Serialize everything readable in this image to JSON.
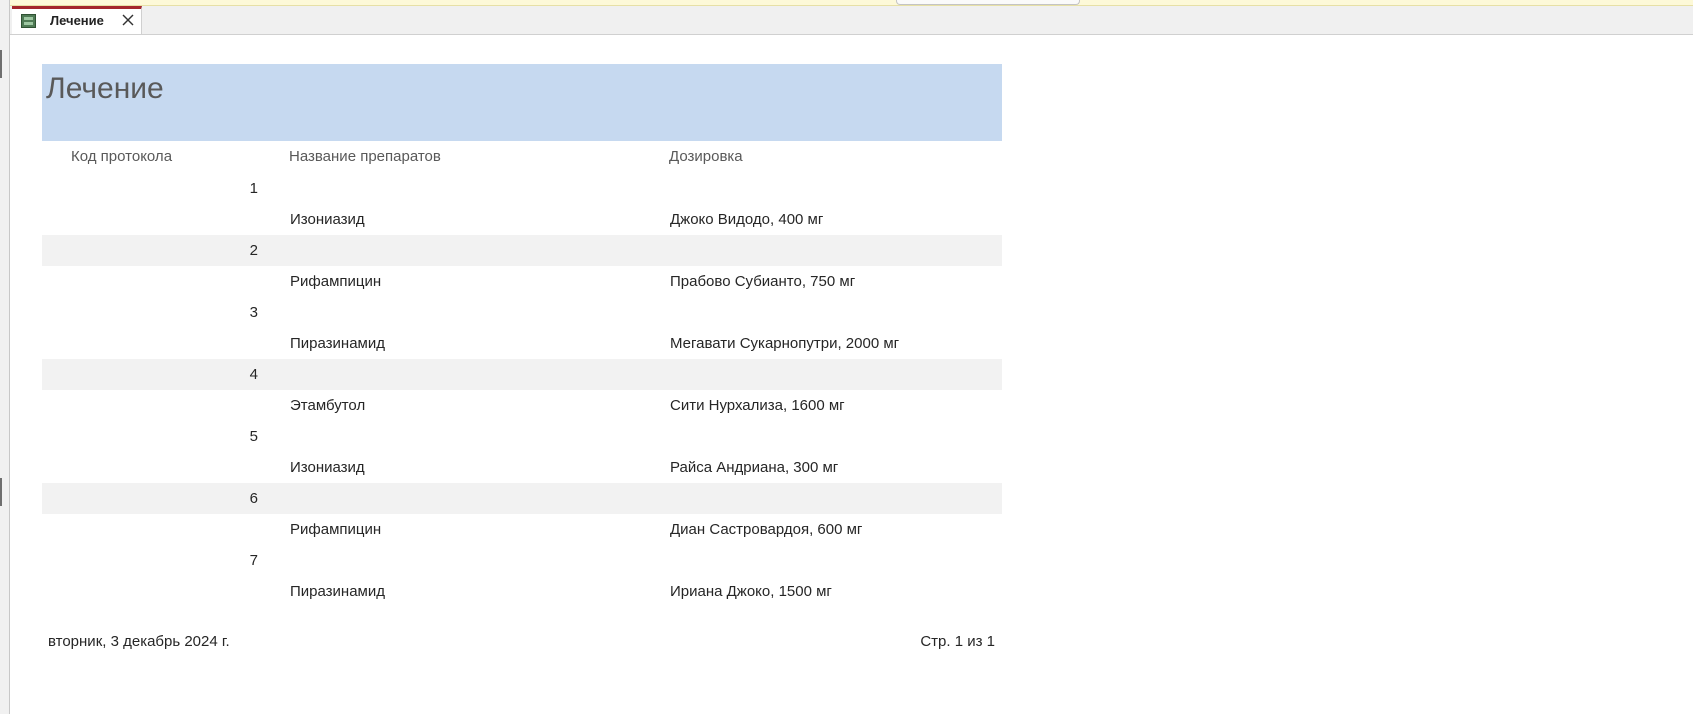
{
  "tab": {
    "label": "Лечение",
    "icon": "report-icon",
    "close_icon": "close-icon"
  },
  "report": {
    "title": "Лечение",
    "columns": {
      "code": "Код протокола",
      "drug": "Название препаратов",
      "dose": "Дозировка"
    },
    "rows": [
      {
        "code": "1",
        "drug": "Изониазид",
        "dose": "Джоко Видодо, 400 мг"
      },
      {
        "code": "2",
        "drug": "Рифампицин",
        "dose": "Прабово Субианто, 750 мг"
      },
      {
        "code": "3",
        "drug": "Пиразинамид",
        "dose": "Мегавати Сукарнопутри, 2000 мг"
      },
      {
        "code": "4",
        "drug": "Этамбутол",
        "dose": "Сити Нурхализа, 1600 мг"
      },
      {
        "code": "5",
        "drug": "Изониазид",
        "dose": "Райса Андриана, 300 мг"
      },
      {
        "code": "6",
        "drug": "Рифампицин",
        "dose": "Диан Састровардоя, 600 мг"
      },
      {
        "code": "7",
        "drug": "Пиразинамид",
        "dose": "Ириана Джоко, 1500 мг"
      }
    ],
    "footer": {
      "date": "вторник, 3 декабрь 2024 г.",
      "page": "Стр. 1 из 1"
    }
  },
  "colors": {
    "header_band": "#c6d9f0",
    "alt_band": "#f2f2f2",
    "tab_accent": "#a4262c"
  }
}
